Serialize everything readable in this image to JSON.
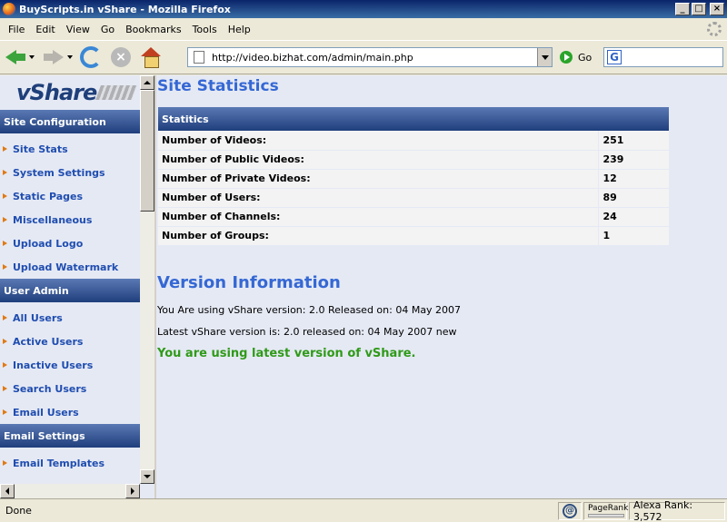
{
  "window": {
    "title": "BuyScripts.in vShare - Mozilla Firefox"
  },
  "menubar": [
    "File",
    "Edit",
    "View",
    "Go",
    "Bookmarks",
    "Tools",
    "Help"
  ],
  "toolbar": {
    "url": "http://video.bizhat.com/admin/main.php",
    "go_label": "Go",
    "search_placeholder": ""
  },
  "sidebar": {
    "logo": "vShare",
    "sections": [
      {
        "header": "Site Configuration",
        "items": [
          "Site Stats",
          "System Settings",
          "Static Pages",
          "Miscellaneous",
          "Upload Logo",
          "Upload Watermark"
        ]
      },
      {
        "header": "User Admin",
        "items": [
          "All Users",
          "Active Users",
          "Inactive Users",
          "Search Users",
          "Email Users"
        ]
      },
      {
        "header": "Email Settings",
        "items": [
          "Email Templates"
        ]
      }
    ]
  },
  "main": {
    "title": "Site Statistics",
    "table": {
      "header": "Statitics",
      "rows": [
        {
          "label": "Number of Videos:",
          "value": "251"
        },
        {
          "label": "Number of Public Videos:",
          "value": "239"
        },
        {
          "label": "Number of Private Videos:",
          "value": "12"
        },
        {
          "label": "Number of Users:",
          "value": "89"
        },
        {
          "label": "Number of Channels:",
          "value": "24"
        },
        {
          "label": "Number of Groups:",
          "value": "1"
        }
      ]
    },
    "version": {
      "title": "Version Information",
      "current": "You Are using vShare version: 2.0 Released on: 04 May 2007",
      "latest": "Latest vShare version is: 2.0 released on: 04 May 2007 new",
      "message": "You are using latest version of vShare."
    }
  },
  "statusbar": {
    "text": "Done",
    "pagerank_label": "PageRank",
    "alexa": "Alexa Rank: 3,572"
  }
}
